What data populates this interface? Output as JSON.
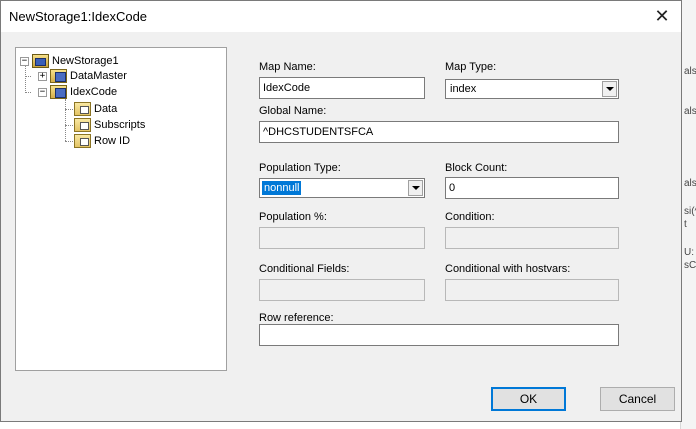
{
  "window": {
    "title": "NewStorage1:IdexCode",
    "close_glyph": "✕"
  },
  "tree": {
    "root": {
      "label": "NewStorage1",
      "expander": "−",
      "icon": "storage-icon"
    },
    "children": [
      {
        "label": "DataMaster",
        "expander": "+",
        "icon": "map-icon"
      },
      {
        "label": "IdexCode",
        "expander": "−",
        "icon": "map-icon"
      }
    ],
    "leaves": [
      {
        "label": "Data",
        "icon": "data-icon"
      },
      {
        "label": "Subscripts",
        "icon": "subscripts-icon"
      },
      {
        "label": "Row ID",
        "icon": "rowid-icon"
      }
    ]
  },
  "form": {
    "map_name": {
      "label": "Map Name:",
      "value": "IdexCode"
    },
    "map_type": {
      "label": "Map Type:",
      "value": "index"
    },
    "global_name": {
      "label": "Global Name:",
      "value": "^DHCSTUDENTSFCA"
    },
    "population_type": {
      "label": "Population Type:",
      "value": "nonnull"
    },
    "block_count": {
      "label": "Block Count:",
      "value": "0"
    },
    "population_pct": {
      "label": "Population %:",
      "value": ""
    },
    "condition": {
      "label": "Condition:",
      "value": ""
    },
    "conditional_fields": {
      "label": "Conditional Fields:",
      "value": ""
    },
    "conditional_hostvars": {
      "label": "Conditional with hostvars:",
      "value": ""
    },
    "row_reference": {
      "label": "Row reference:",
      "value": ""
    }
  },
  "buttons": {
    "ok": "OK",
    "cancel": "Cancel"
  },
  "background": {
    "right_snippets": [
      "als",
      "als",
      "als",
      "si(^",
      "t",
      "U:",
      "sC"
    ]
  },
  "colors": {
    "selection": "#0078d7",
    "dialog_bg": "#f0f0f0"
  }
}
